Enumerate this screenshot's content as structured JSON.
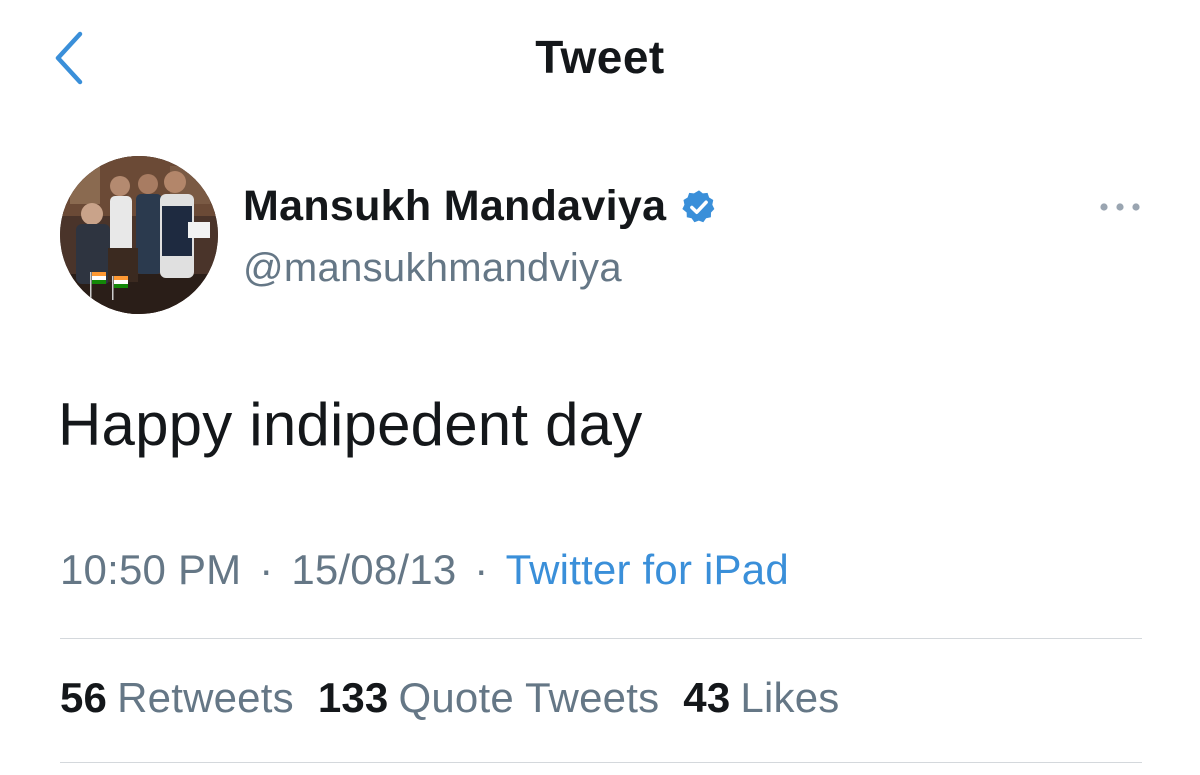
{
  "colors": {
    "accent": "#3a8fd9",
    "text_primary": "#14171a",
    "text_secondary": "#657786",
    "divider": "#d4d8dc"
  },
  "header": {
    "back_icon": "chevron-left-icon",
    "title": "Tweet"
  },
  "author": {
    "display_name": "Mansukh Mandaviya",
    "verified": true,
    "handle": "@mansukhmandviya",
    "more_icon": "ellipsis-icon"
  },
  "tweet": {
    "text": "Happy indipedent day",
    "time": "10:50 PM",
    "date": "15/08/13",
    "separator": "·",
    "source": "Twitter for iPad"
  },
  "stats": {
    "retweets": {
      "count": "56",
      "label": "Retweets"
    },
    "quote_tweets": {
      "count": "133",
      "label": "Quote Tweets"
    },
    "likes": {
      "count": "43",
      "label": "Likes"
    }
  }
}
